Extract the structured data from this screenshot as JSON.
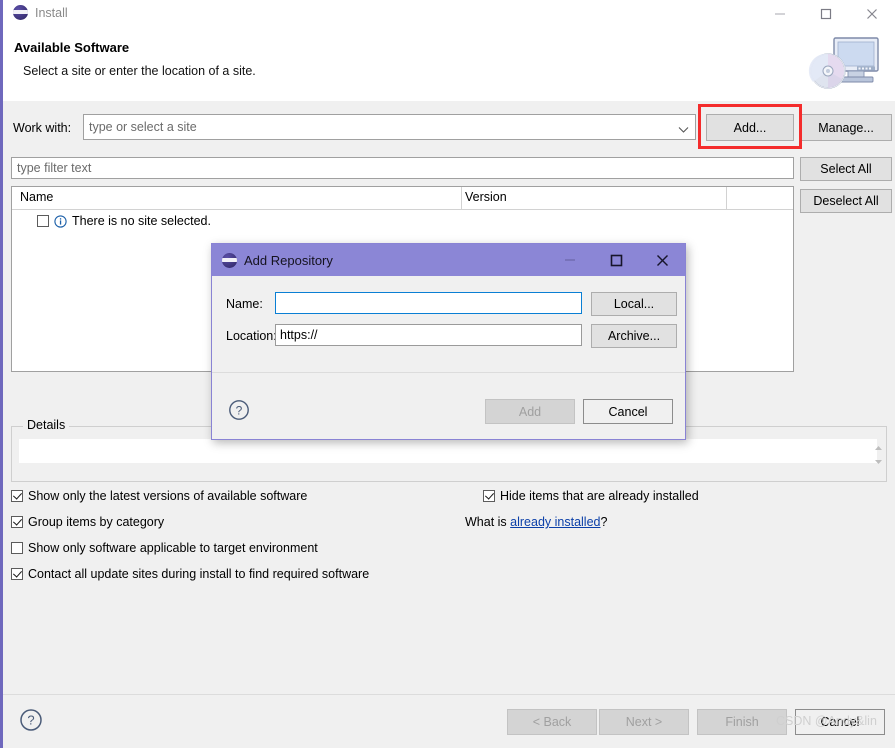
{
  "window": {
    "title": "Install",
    "icon": "eclipse-logo-icon",
    "controls": {
      "minimize": "minimize-icon",
      "maximize": "maximize-icon",
      "close": "close-icon"
    }
  },
  "header": {
    "title": "Available Software",
    "subtitle": "Select a site or enter the location of a site.",
    "icon": "install-computer-cd-icon"
  },
  "work_with": {
    "label": "Work with:",
    "placeholder": "type or select a site",
    "value": "",
    "dropdown_icon": "chevron-down-icon",
    "add_label": "Add...",
    "manage_label": "Manage...",
    "highlight_color": "#f42c2c"
  },
  "filter": {
    "placeholder": "type filter text",
    "value": ""
  },
  "side_buttons": {
    "select_all": "Select All",
    "deselect_all": "Deselect All"
  },
  "table": {
    "columns": [
      "Name",
      "Version"
    ],
    "rows": [
      {
        "checked": false,
        "icon": "info-icon",
        "name": "There is no site selected.",
        "version": ""
      }
    ]
  },
  "details": {
    "legend": "Details",
    "value": "",
    "scroll_up_icon": "scroll-up-icon",
    "scroll_down_icon": "scroll-down-icon"
  },
  "options": {
    "left": [
      {
        "label": "Show only the latest versions of available software",
        "checked": true
      },
      {
        "label": "Group items by category",
        "checked": true
      },
      {
        "label": "Show only software applicable to target environment",
        "checked": false
      },
      {
        "label": "Contact all update sites during install to find required software",
        "checked": true
      }
    ],
    "right": [
      {
        "label": "Hide items that are already installed",
        "checked": true
      }
    ],
    "what_is_prefix": "What is ",
    "what_is_link": "already installed",
    "what_is_suffix": "?"
  },
  "wizard_buttons": {
    "help_icon": "help-circle-icon",
    "back": "< Back",
    "next": "Next >",
    "finish": "Finish",
    "cancel": "Cancel"
  },
  "watermark": "CSDN @Andy&lin",
  "dialog": {
    "title": "Add Repository",
    "icon": "eclipse-logo-icon",
    "titlebar_color": "#8b86d6",
    "controls": {
      "minimize": "minimize-icon",
      "maximize": "maximize-icon",
      "close": "close-icon"
    },
    "name_label": "Name:",
    "name_value": "",
    "location_label": "Location:",
    "location_value": "https://",
    "local_label": "Local...",
    "archive_label": "Archive...",
    "help_icon": "help-circle-icon",
    "add_label": "Add",
    "cancel_label": "Cancel"
  }
}
